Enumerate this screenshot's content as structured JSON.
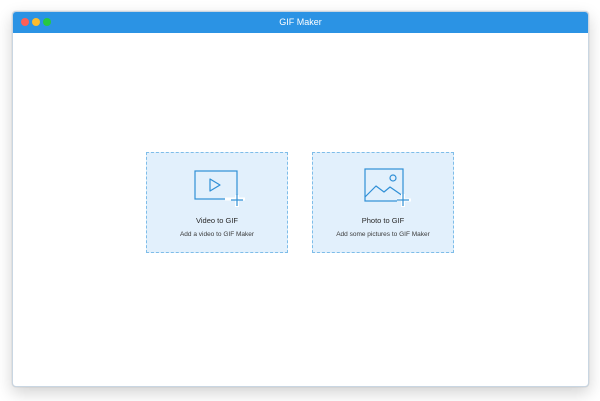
{
  "window": {
    "title": "GIF Maker"
  },
  "colors": {
    "titlebar": "#2b93e4",
    "card_bg": "#e2f0fc",
    "card_border": "#7ebde9",
    "icon_stroke": "#2f8fd6"
  },
  "cards": [
    {
      "title": "Video to GIF",
      "subtitle": "Add a video to GIF Maker",
      "icon": "video-add-icon"
    },
    {
      "title": "Photo to GIF",
      "subtitle": "Add some pictures to GIF Maker",
      "icon": "photo-add-icon"
    }
  ]
}
